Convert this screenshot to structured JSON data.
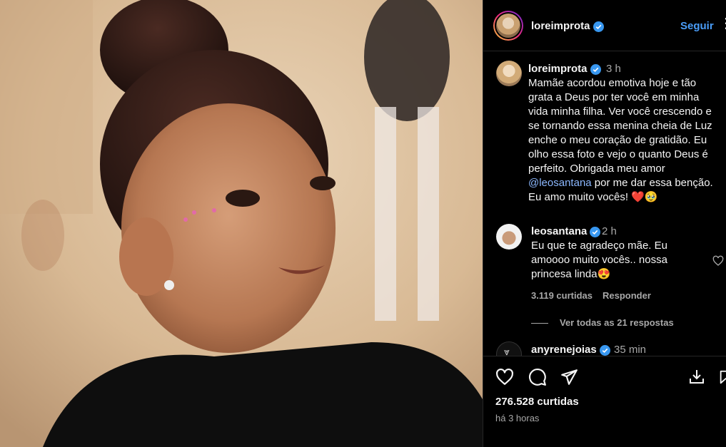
{
  "post": {
    "username": "loreimprota",
    "follow_label": "Seguir",
    "more_label": "⋮",
    "caption_username": "loreimprota",
    "caption_time": "3 h",
    "caption_part1": "Mamãe acordou emotiva hoje e tão grata a Deus por ter você em minha vida minha filha. Ver você crescendo e se tornando essa menina cheia de Luz enche o meu coração de gratidão. Eu olho essa foto e vejo o quanto Deus é perfeito. Obrigada meu amor ",
    "caption_mention": "@leosantana",
    "caption_part2": " por me dar essa benção. Eu amo muito vocês! ❤️🥹",
    "likes": "276.528 curtidas",
    "posted_ago": "há 3 horas"
  },
  "comments": [
    {
      "username": "leosantana",
      "time": "2 h",
      "text": "Eu que te agradeço mãe. Eu amoooo muito vocês.. nossa princesa linda😍",
      "likes": "3.119 curtidas",
      "reply_label": "Responder",
      "view_replies": "Ver todas as 21 respostas"
    },
    {
      "username": "anyrenejoias",
      "time": "35 min",
      "avatar_glyph": "⩔"
    }
  ],
  "colors": {
    "accent": "#4a9df8",
    "verified": "#3897f0",
    "muted": "#a8a8a8"
  },
  "icons": [
    "heart-icon",
    "comment-icon",
    "share-icon",
    "save-icon",
    "verified-icon",
    "more-icon"
  ]
}
